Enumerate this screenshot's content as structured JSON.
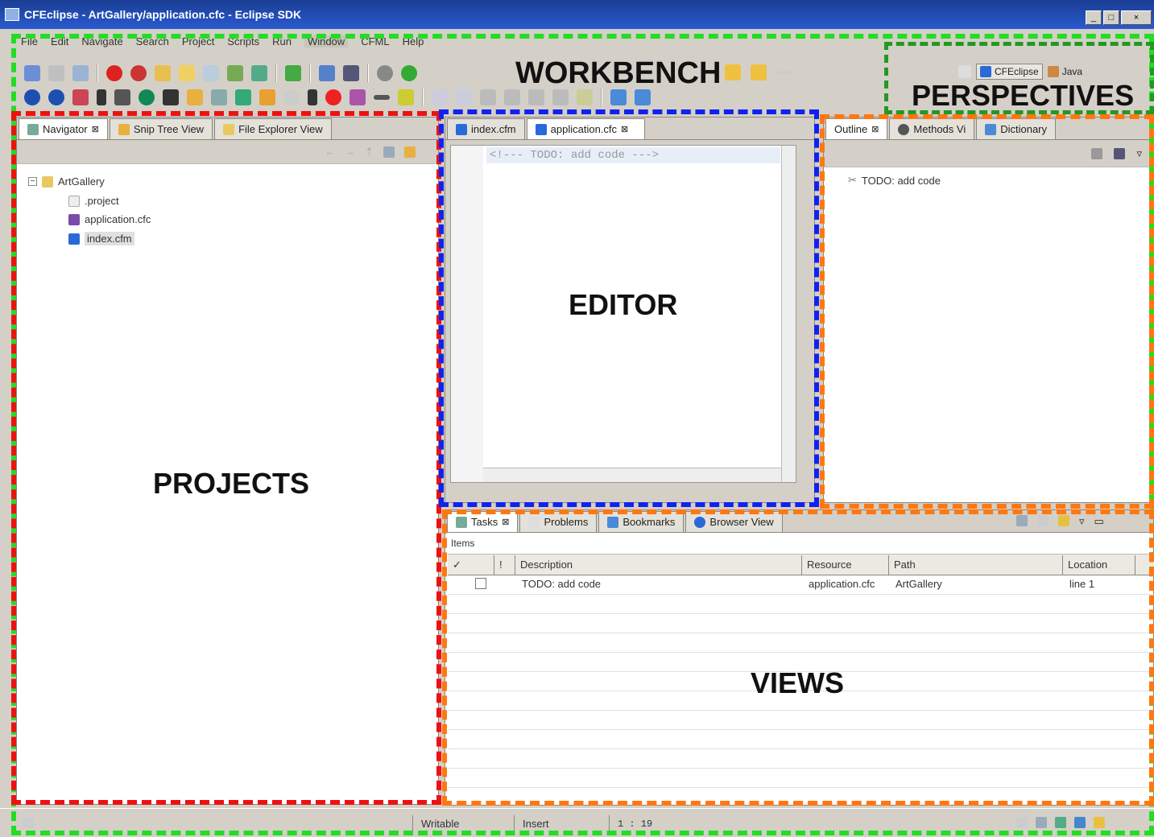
{
  "window": {
    "title": "CFEclipse - ArtGallery/application.cfc - Eclipse SDK",
    "controls": [
      "_",
      "□",
      "×"
    ]
  },
  "menu": [
    "File",
    "Edit",
    "Navigate",
    "Search",
    "Project",
    "Scripts",
    "Run",
    "Window",
    "CFML",
    "Help"
  ],
  "perspectives": {
    "items": [
      {
        "label": "CFEclipse"
      },
      {
        "label": "Java"
      }
    ]
  },
  "navigator": {
    "tabs": [
      {
        "label": "Navigator"
      },
      {
        "label": "Snip Tree View"
      },
      {
        "label": "File Explorer View"
      }
    ],
    "tree": {
      "root": "ArtGallery",
      "children": [
        ".project",
        "application.cfc",
        "index.cfm"
      ]
    }
  },
  "editor": {
    "tabs": [
      {
        "label": "index.cfm"
      },
      {
        "label": "application.cfc"
      }
    ],
    "code_line": "<!--- TODO: add code --->"
  },
  "outline": {
    "tabs": [
      {
        "label": "Outline"
      },
      {
        "label": "Methods Vi"
      },
      {
        "label": "Dictionary"
      }
    ],
    "item": "TODO: add code"
  },
  "views": {
    "tabs": [
      {
        "label": "Tasks"
      },
      {
        "label": "Problems"
      },
      {
        "label": "Bookmarks"
      },
      {
        "label": "Browser View"
      }
    ],
    "items_label": "Items",
    "columns": [
      "✓",
      "!",
      "Description",
      "Resource",
      "Path",
      "Location"
    ],
    "rows": [
      {
        "description": "TODO: add code",
        "resource": "application.cfc",
        "path": "ArtGallery",
        "location": "line 1"
      }
    ]
  },
  "status": {
    "writable": "Writable",
    "insert": "Insert",
    "position": "1 : 19"
  },
  "annotations": {
    "workbench": "WORKBENCH",
    "perspectives": "PERSPECTIVES",
    "projects": "PROJECTS",
    "editor": "EDITOR",
    "views": "VIEWS"
  },
  "colors": {
    "workbench": "#22dd22",
    "perspectives": "#229922",
    "projects": "#ee1111",
    "editor": "#1122ee",
    "views": "#ff7711"
  }
}
